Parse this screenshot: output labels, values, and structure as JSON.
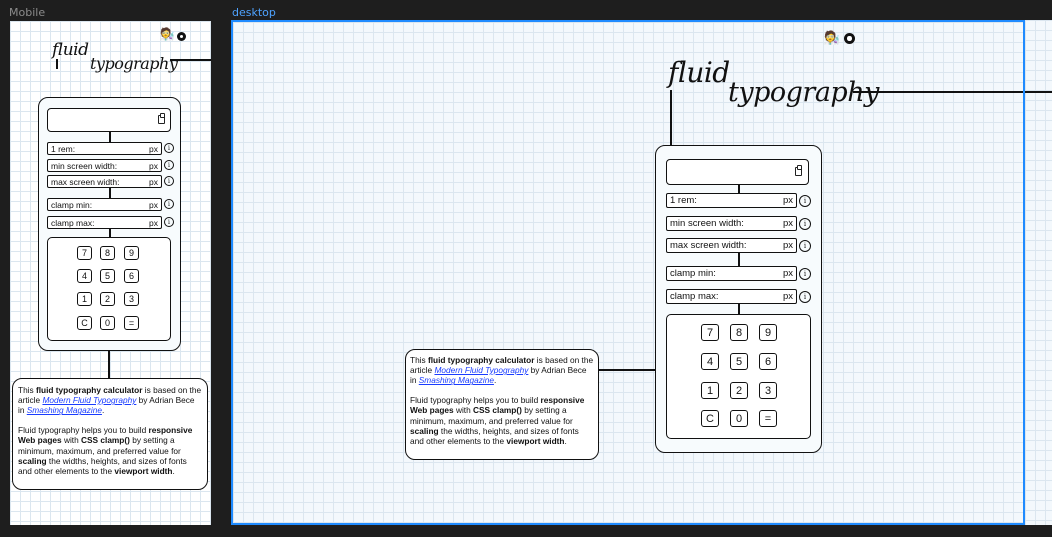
{
  "frames": {
    "mobile_label": "Mobile",
    "desktop_label": "desktop"
  },
  "header": {
    "title_line1": "fluid",
    "title_line2": "typography",
    "avatar_glyph": "🧑‍🔬",
    "github_icon": "github-icon"
  },
  "calculator": {
    "fields": [
      {
        "label": "1 rem:",
        "unit": "px"
      },
      {
        "label": "min screen width:",
        "unit": "px"
      },
      {
        "label": "max screen width:",
        "unit": "px"
      },
      {
        "label": "clamp min:",
        "unit": "px"
      },
      {
        "label": "clamp max:",
        "unit": "px"
      }
    ],
    "info_glyph": "i",
    "keys": [
      "7",
      "8",
      "9",
      "4",
      "5",
      "6",
      "1",
      "2",
      "3",
      "C",
      "0",
      "="
    ]
  },
  "description": {
    "p1_a": "This ",
    "p1_b": "fluid typography calculator",
    "p1_c": " is based on the article ",
    "p1_link1": "Modern Fluid Typography",
    "p1_d": " by Adrian Bece in ",
    "p1_link2": "Smashing Magazine",
    "p1_e": ".",
    "p2_a": "Fluid typography helps you to build ",
    "p2_b": "responsive Web pages",
    "p2_c": " with ",
    "p2_d": "CSS clamp()",
    "p2_e": " by setting a minimum, maximum, and preferred value for ",
    "p2_f": "scaling",
    "p2_g": " the widths, heights, and sizes of fonts and other elements to the ",
    "p2_h": "viewport width",
    "p2_i": "."
  },
  "colors": {
    "canvas": "#1e1e1e",
    "selection": "#1f8bff",
    "link": "#1a3cff"
  }
}
